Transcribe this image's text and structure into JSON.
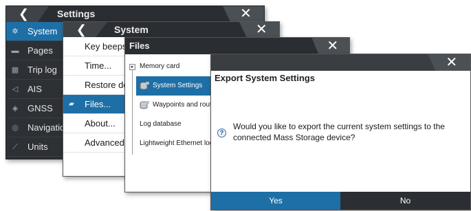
{
  "settings_window": {
    "title": "Settings",
    "back_glyph": "❮",
    "close_glyph": "✕",
    "sidebar": [
      {
        "label": "System",
        "icon": "gear-icon",
        "selected": true
      },
      {
        "label": "Pages",
        "icon": "pages-icon",
        "selected": false
      },
      {
        "label": "Trip log",
        "icon": "trip-log-icon",
        "selected": false
      },
      {
        "label": "AIS",
        "icon": "ais-icon",
        "selected": false
      },
      {
        "label": "GNSS",
        "icon": "gnss-icon",
        "selected": false
      },
      {
        "label": "Navigation",
        "icon": "compass-icon",
        "selected": false
      },
      {
        "label": "Units",
        "icon": "units-icon",
        "selected": false
      }
    ]
  },
  "system_window": {
    "title": "System",
    "back_glyph": "❮",
    "close_glyph": "✕",
    "items": [
      {
        "label": "Key beeps",
        "selected": false
      },
      {
        "label": "Time...",
        "selected": false
      },
      {
        "label": "Restore defaults...",
        "selected": false
      },
      {
        "label": "Files...",
        "selected": true,
        "icon": "folder-icon"
      },
      {
        "label": "About...",
        "selected": false
      },
      {
        "label": "Advanced",
        "selected": false
      }
    ]
  },
  "files_window": {
    "title": "Files",
    "close_glyph": "✕",
    "tree": [
      {
        "label": "Memory card",
        "expander": "▸"
      },
      {
        "label": "System Settings",
        "selected": true,
        "icon": "database-icon"
      },
      {
        "label": "Waypoints and routes",
        "icon": "database-icon"
      },
      {
        "label": "Log database"
      },
      {
        "label": "Lightweight Ethernet log"
      }
    ]
  },
  "export_dialog": {
    "title": "Export System Settings",
    "close_glyph": "✕",
    "question_glyph": "?",
    "message": "Would you like to export the current system settings to the connected Mass Storage device?",
    "yes_label": "Yes",
    "no_label": "No"
  },
  "colors": {
    "accent": "#1e6fa6",
    "titlebar": "#2a2d31",
    "sidebar_bg": "#2d3034",
    "no_button": "#2b2e32"
  }
}
